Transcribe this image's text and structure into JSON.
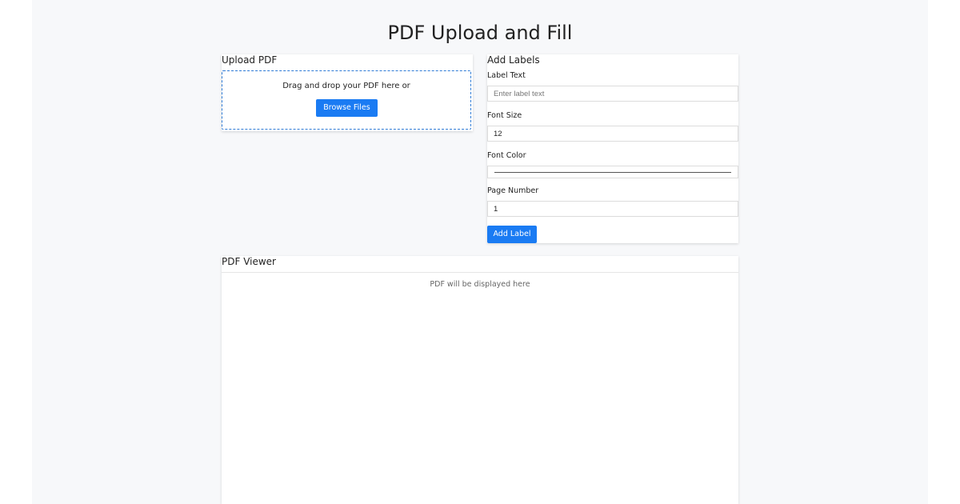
{
  "header": {
    "title": "PDF Upload and Fill"
  },
  "upload": {
    "title": "Upload PDF",
    "drop_text": "Drag and drop your PDF here or",
    "browse_label": "Browse Files"
  },
  "labels": {
    "title": "Add Labels",
    "label_text": {
      "label": "Label Text",
      "placeholder": "Enter label text",
      "value": ""
    },
    "font_size": {
      "label": "Font Size",
      "value": "12"
    },
    "font_color": {
      "label": "Font Color",
      "value": "#555555"
    },
    "page_number": {
      "label": "Page Number",
      "value": "1"
    },
    "add_label": "Add Label"
  },
  "viewer": {
    "title": "PDF Viewer",
    "placeholder": "PDF will be displayed here"
  },
  "colors": {
    "accent": "#1a7bf3",
    "dropzone_border": "#2e7bd6",
    "background": "#f7f8fa"
  }
}
